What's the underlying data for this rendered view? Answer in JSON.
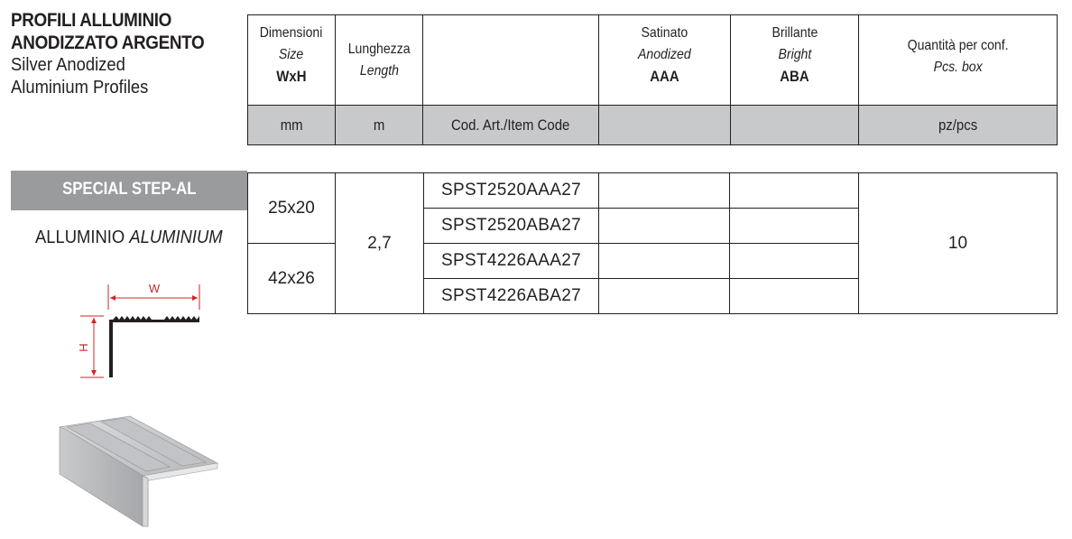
{
  "title": {
    "line1": "PROFILI ALLUMINIO",
    "line2": "ANODIZZATO ARGENTO",
    "line3": "Silver Anodized",
    "line4": "Aluminium Profiles"
  },
  "header": {
    "dimensioni": "Dimensioni",
    "size": "Size",
    "wxh": "WxH",
    "lunghezza": "Lunghezza",
    "length": "Length",
    "satinato": "Satinato",
    "anodized": "Anodized",
    "aaa": "AAA",
    "brillante": "Brillante",
    "bright": "Bright",
    "aba": "ABA",
    "quantita": "Quantità per conf.",
    "pcs_box": "Pcs. box",
    "unit_mm": "mm",
    "unit_m": "m",
    "unit_code": "Cod. Art./Item Code",
    "unit_pcs": "pz/pcs"
  },
  "section": {
    "name": "SPECIAL STEP-AL",
    "material": "ALLUMINIO",
    "material_en": "ALUMINIUM"
  },
  "diagram": {
    "w_label": "W",
    "h_label": "H",
    "accent_color": "#d2232a"
  },
  "rows": [
    {
      "size": "25x20",
      "length": "2,7",
      "code": "SPST2520AAA27",
      "qty": "10"
    },
    {
      "code": "SPST2520ABA27"
    },
    {
      "size": "42x26",
      "code": "SPST4226AAA27"
    },
    {
      "code": "SPST4226ABA27"
    }
  ]
}
